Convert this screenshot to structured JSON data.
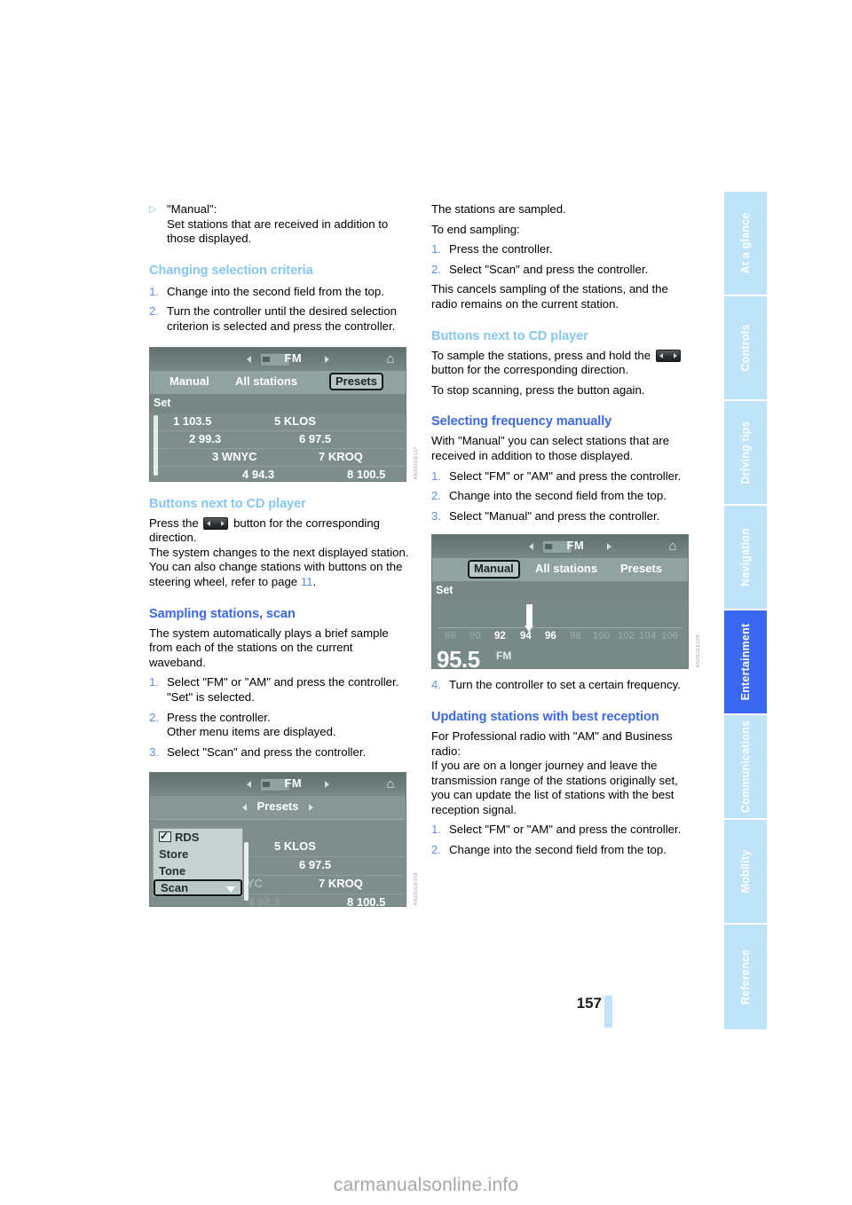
{
  "document": {
    "page_number": "157",
    "watermark": "carmanualsonline.info"
  },
  "sidebar": {
    "tabs": [
      {
        "label": "At a glance",
        "active": false
      },
      {
        "label": "Controls",
        "active": false
      },
      {
        "label": "Driving tips",
        "active": false
      },
      {
        "label": "Navigation",
        "active": false
      },
      {
        "label": "Entertainment",
        "active": true
      },
      {
        "label": "Communications",
        "active": false
      },
      {
        "label": "Mobility",
        "active": false
      },
      {
        "label": "Reference",
        "active": false
      }
    ]
  },
  "colors": {
    "heading_main": "#3B68F0",
    "heading_sub": "#85C7F2",
    "list_marker": "#5B8DEF",
    "tab_inactive": "#BFE4FA",
    "tab_active": "#3B68F0"
  },
  "left_column": {
    "bullet_manual": {
      "marker": "▷",
      "line1": "\"Manual\":",
      "line2": "Set stations that are received in addition to",
      "line3": "those displayed."
    },
    "heading_changing": "Changing selection criteria",
    "step1": {
      "num": "1.",
      "text": "Change into the second field from the top."
    },
    "step2": {
      "num": "2.",
      "text": "Turn the controller until the desired selection criterion is selected and press the controller."
    },
    "heading_buttons_cd": "Buttons next to CD player",
    "press_the": "Press the",
    "button_for": "button for the corresponding direction.",
    "sys_changes": "The system changes to the next displayed station.",
    "also_change_a": "You can also change stations with buttons on the steering wheel, refer to page",
    "page_ref": "11",
    "period": ".",
    "heading_sampling": "Sampling stations, scan",
    "sampling_intro": "The system automatically plays a brief sample from each of the stations on the current waveband.",
    "s1": {
      "num": "1.",
      "text": "Select \"FM\" or \"AM\" and press the controller.",
      "sub": "\"Set\" is selected."
    },
    "s2": {
      "num": "2.",
      "text": "Press the controller.",
      "sub": "Other menu items are displayed."
    },
    "s3": {
      "num": "3.",
      "text": "Select \"Scan\" and press the controller."
    }
  },
  "right_column": {
    "stations_sampled": "The stations are sampled.",
    "to_end": "To end sampling:",
    "e1": {
      "num": "1.",
      "text": "Press the controller."
    },
    "e2": {
      "num": "2.",
      "text": "Select \"Scan\" and press the controller."
    },
    "cancels": "This cancels sampling of the stations, and the radio remains on the current station.",
    "heading_buttons_cd": "Buttons next to CD player",
    "to_sample": "To sample the stations, press and hold the",
    "button_for": "button for the corresponding direction.",
    "to_stop": "To stop scanning, press the button again.",
    "heading_selecting": "Selecting frequency manually",
    "with_manual": "With \"Manual\" you can select stations that are received in addition to those displayed.",
    "m1": {
      "num": "1.",
      "text": "Select \"FM\" or \"AM\" and press the controller."
    },
    "m2": {
      "num": "2.",
      "text": "Change into the second field from the top."
    },
    "m3": {
      "num": "3.",
      "text": "Select \"Manual\" and press the controller."
    },
    "m4": {
      "num": "4.",
      "text": "Turn the controller to set a certain frequency."
    },
    "heading_updating": "Updating stations with best reception",
    "for_professional": "For Professional radio with \"AM\" and Business radio:",
    "if_longer": "If you are on a longer journey and leave the transmission range of the stations originally set, you can update the list of stations with the best reception signal.",
    "u1": {
      "num": "1.",
      "text": "Select \"FM\" or \"AM\" and press the controller."
    },
    "u2": {
      "num": "2.",
      "text": "Change into the second field from the top."
    }
  },
  "figure_presets": {
    "band": "FM",
    "menu": [
      {
        "label": "Manual",
        "selected": false
      },
      {
        "label": "All stations",
        "selected": false
      },
      {
        "label": "Presets",
        "selected": true
      }
    ],
    "set_label": "Set",
    "rows": [
      {
        "left": "1 103.5",
        "right": "5 KLOS"
      },
      {
        "left": "2 99.3",
        "right": "6 97.5"
      },
      {
        "left": "3 WNYC",
        "right": "7 KROQ"
      },
      {
        "left": "4 94.3",
        "right": "8 100.5"
      }
    ],
    "code": "ANZEIGE157"
  },
  "figure_scan": {
    "band": "FM",
    "presets_label": "Presets",
    "dropdown": [
      {
        "label": "RDS",
        "checked": true,
        "selected": false
      },
      {
        "label": "Store",
        "checked": false,
        "selected": false
      },
      {
        "label": "Tone",
        "checked": false,
        "selected": false
      },
      {
        "label": "Scan",
        "checked": false,
        "selected": true
      }
    ],
    "rows": [
      {
        "left": "",
        "right": "5 KLOS"
      },
      {
        "left": "",
        "right": "6 97.5"
      },
      {
        "left": "N YC",
        "right": "7 KROQ"
      },
      {
        "left": "4 94.3",
        "right": "8 100.5"
      }
    ],
    "code": "ANZEIGE158"
  },
  "figure_manual": {
    "band": "FM",
    "menu": [
      {
        "label": "Manual",
        "selected": true
      },
      {
        "label": "All stations",
        "selected": false
      },
      {
        "label": "Presets",
        "selected": false
      }
    ],
    "set_label": "Set",
    "scale_ticks": [
      "88",
      "90",
      "92",
      "94",
      "96",
      "98",
      "100",
      "102",
      "104",
      "106"
    ],
    "highlighted_ticks": [
      "92",
      "94",
      "96",
      "98"
    ],
    "current_frequency": "95.5",
    "unit": "FM",
    "code": "ANZEIGE159"
  }
}
